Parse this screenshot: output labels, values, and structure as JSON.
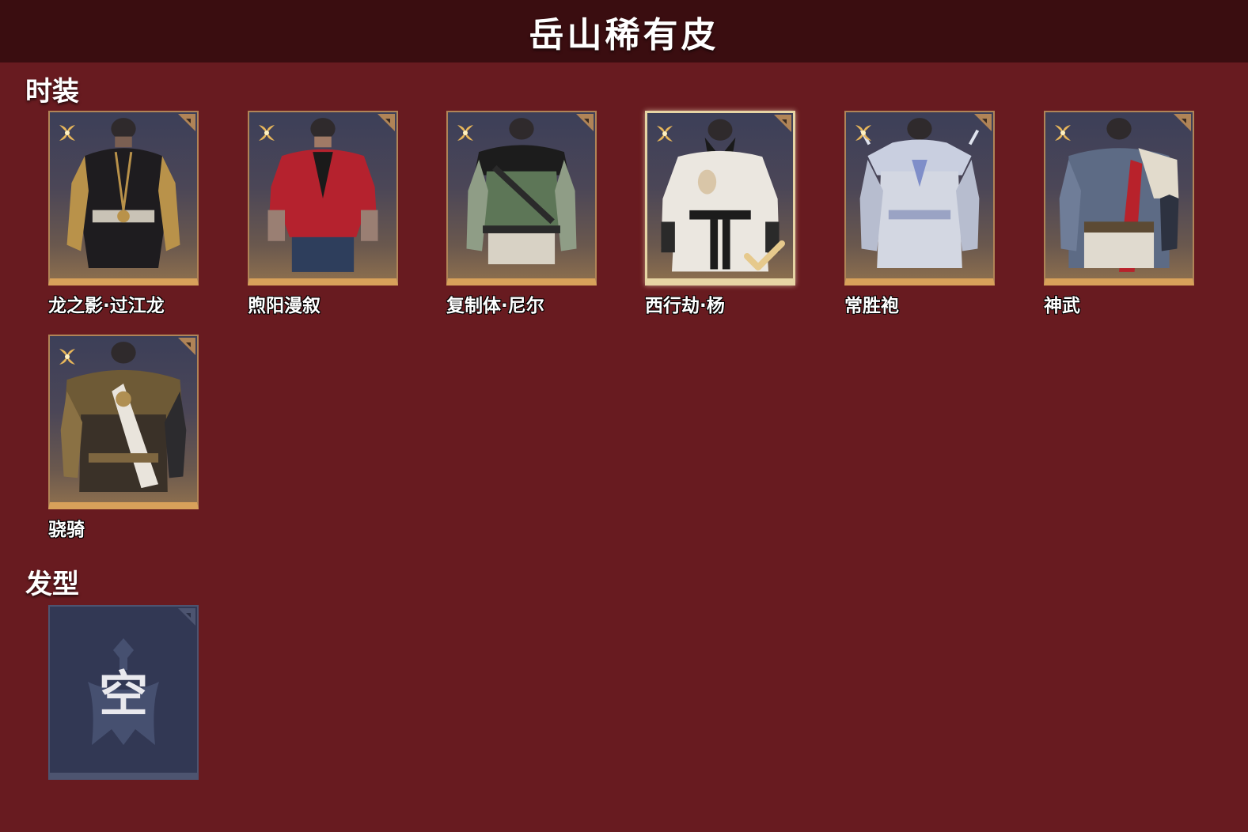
{
  "header": {
    "title": "岳山稀有皮"
  },
  "sections": {
    "outfits": {
      "title": "时装"
    },
    "hairstyles": {
      "title": "发型"
    }
  },
  "outfits": [
    {
      "name": "龙之影·过江龙",
      "icon": "black-gold-dragon-outfit",
      "selected": false
    },
    {
      "name": "煦阳漫叙",
      "icon": "red-shirt-outfit",
      "selected": false
    },
    {
      "name": "复制体·尼尔",
      "icon": "green-vest-outfit",
      "selected": false
    },
    {
      "name": "西行劫·杨",
      "icon": "white-robe-outfit",
      "selected": true
    },
    {
      "name": "常胜袍",
      "icon": "silver-armor-outfit",
      "selected": false
    },
    {
      "name": "神武",
      "icon": "blue-red-armor-outfit",
      "selected": false
    },
    {
      "name": "骁骑",
      "icon": "gold-heavy-armor-outfit",
      "selected": false
    }
  ],
  "hairstyles": [
    {
      "name": "空",
      "icon": "empty-slot-emblem"
    }
  ],
  "colors": {
    "background": "#681b20",
    "header": "#3a0d10",
    "rarity_gold": "#d8a15a",
    "selected_border": "#e6d4a4",
    "empty_slot": "#323854"
  }
}
